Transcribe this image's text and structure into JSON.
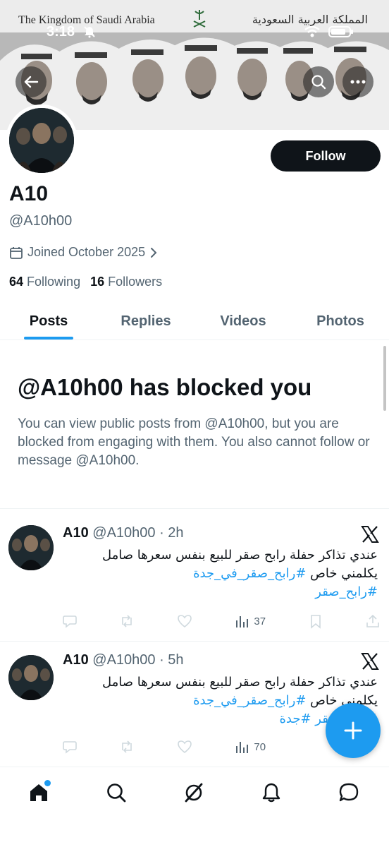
{
  "status_bar": {
    "time": "3:18"
  },
  "banner": {
    "title_en": "The Kingdom of Saudi Arabia",
    "title_ar": "المملكة العربية السعودية"
  },
  "profile": {
    "name": "A10",
    "handle": "@A10h00",
    "joined": "Joined October 2025",
    "following_count": "64",
    "following_label": "Following",
    "followers_count": "16",
    "followers_label": "Followers",
    "follow_label": "Follow"
  },
  "tabs": [
    {
      "label": "Posts",
      "active": true
    },
    {
      "label": "Replies",
      "active": false
    },
    {
      "label": "Videos",
      "active": false
    },
    {
      "label": "Photos",
      "active": false
    }
  ],
  "blocked": {
    "title": "@A10h00 has blocked you",
    "description": "You can view public posts from @A10h00, but you are blocked from engaging with them. You also cannot follow or message @A10h00."
  },
  "posts": [
    {
      "name": "A10",
      "meta": "@A10h00 · 2h",
      "text_line1": "عندي تذاكر حفلة رابح صقر للبيع بنفس سعرها صامل",
      "text_line2_plain": "يكلمني خاص",
      "hashtag1": "#رابح_صقر_في_جدة",
      "hashtag2": "#رابح_صقر",
      "views": "37"
    },
    {
      "name": "A10",
      "meta": "@A10h00 · 5h",
      "text_line1": "عندي تذاكر حفلة رابح صقر للبيع بنفس سعرها صامل",
      "text_line2_plain": "يكلمني خاص",
      "hashtag1": "#رابح_صقر_في_جدة",
      "hashtag2": "#رابح_صقر",
      "hashtag3": "#جدة",
      "views": "70"
    }
  ],
  "colors": {
    "accent": "#1d9bf0",
    "text": "#0f1419",
    "muted": "#536471"
  }
}
